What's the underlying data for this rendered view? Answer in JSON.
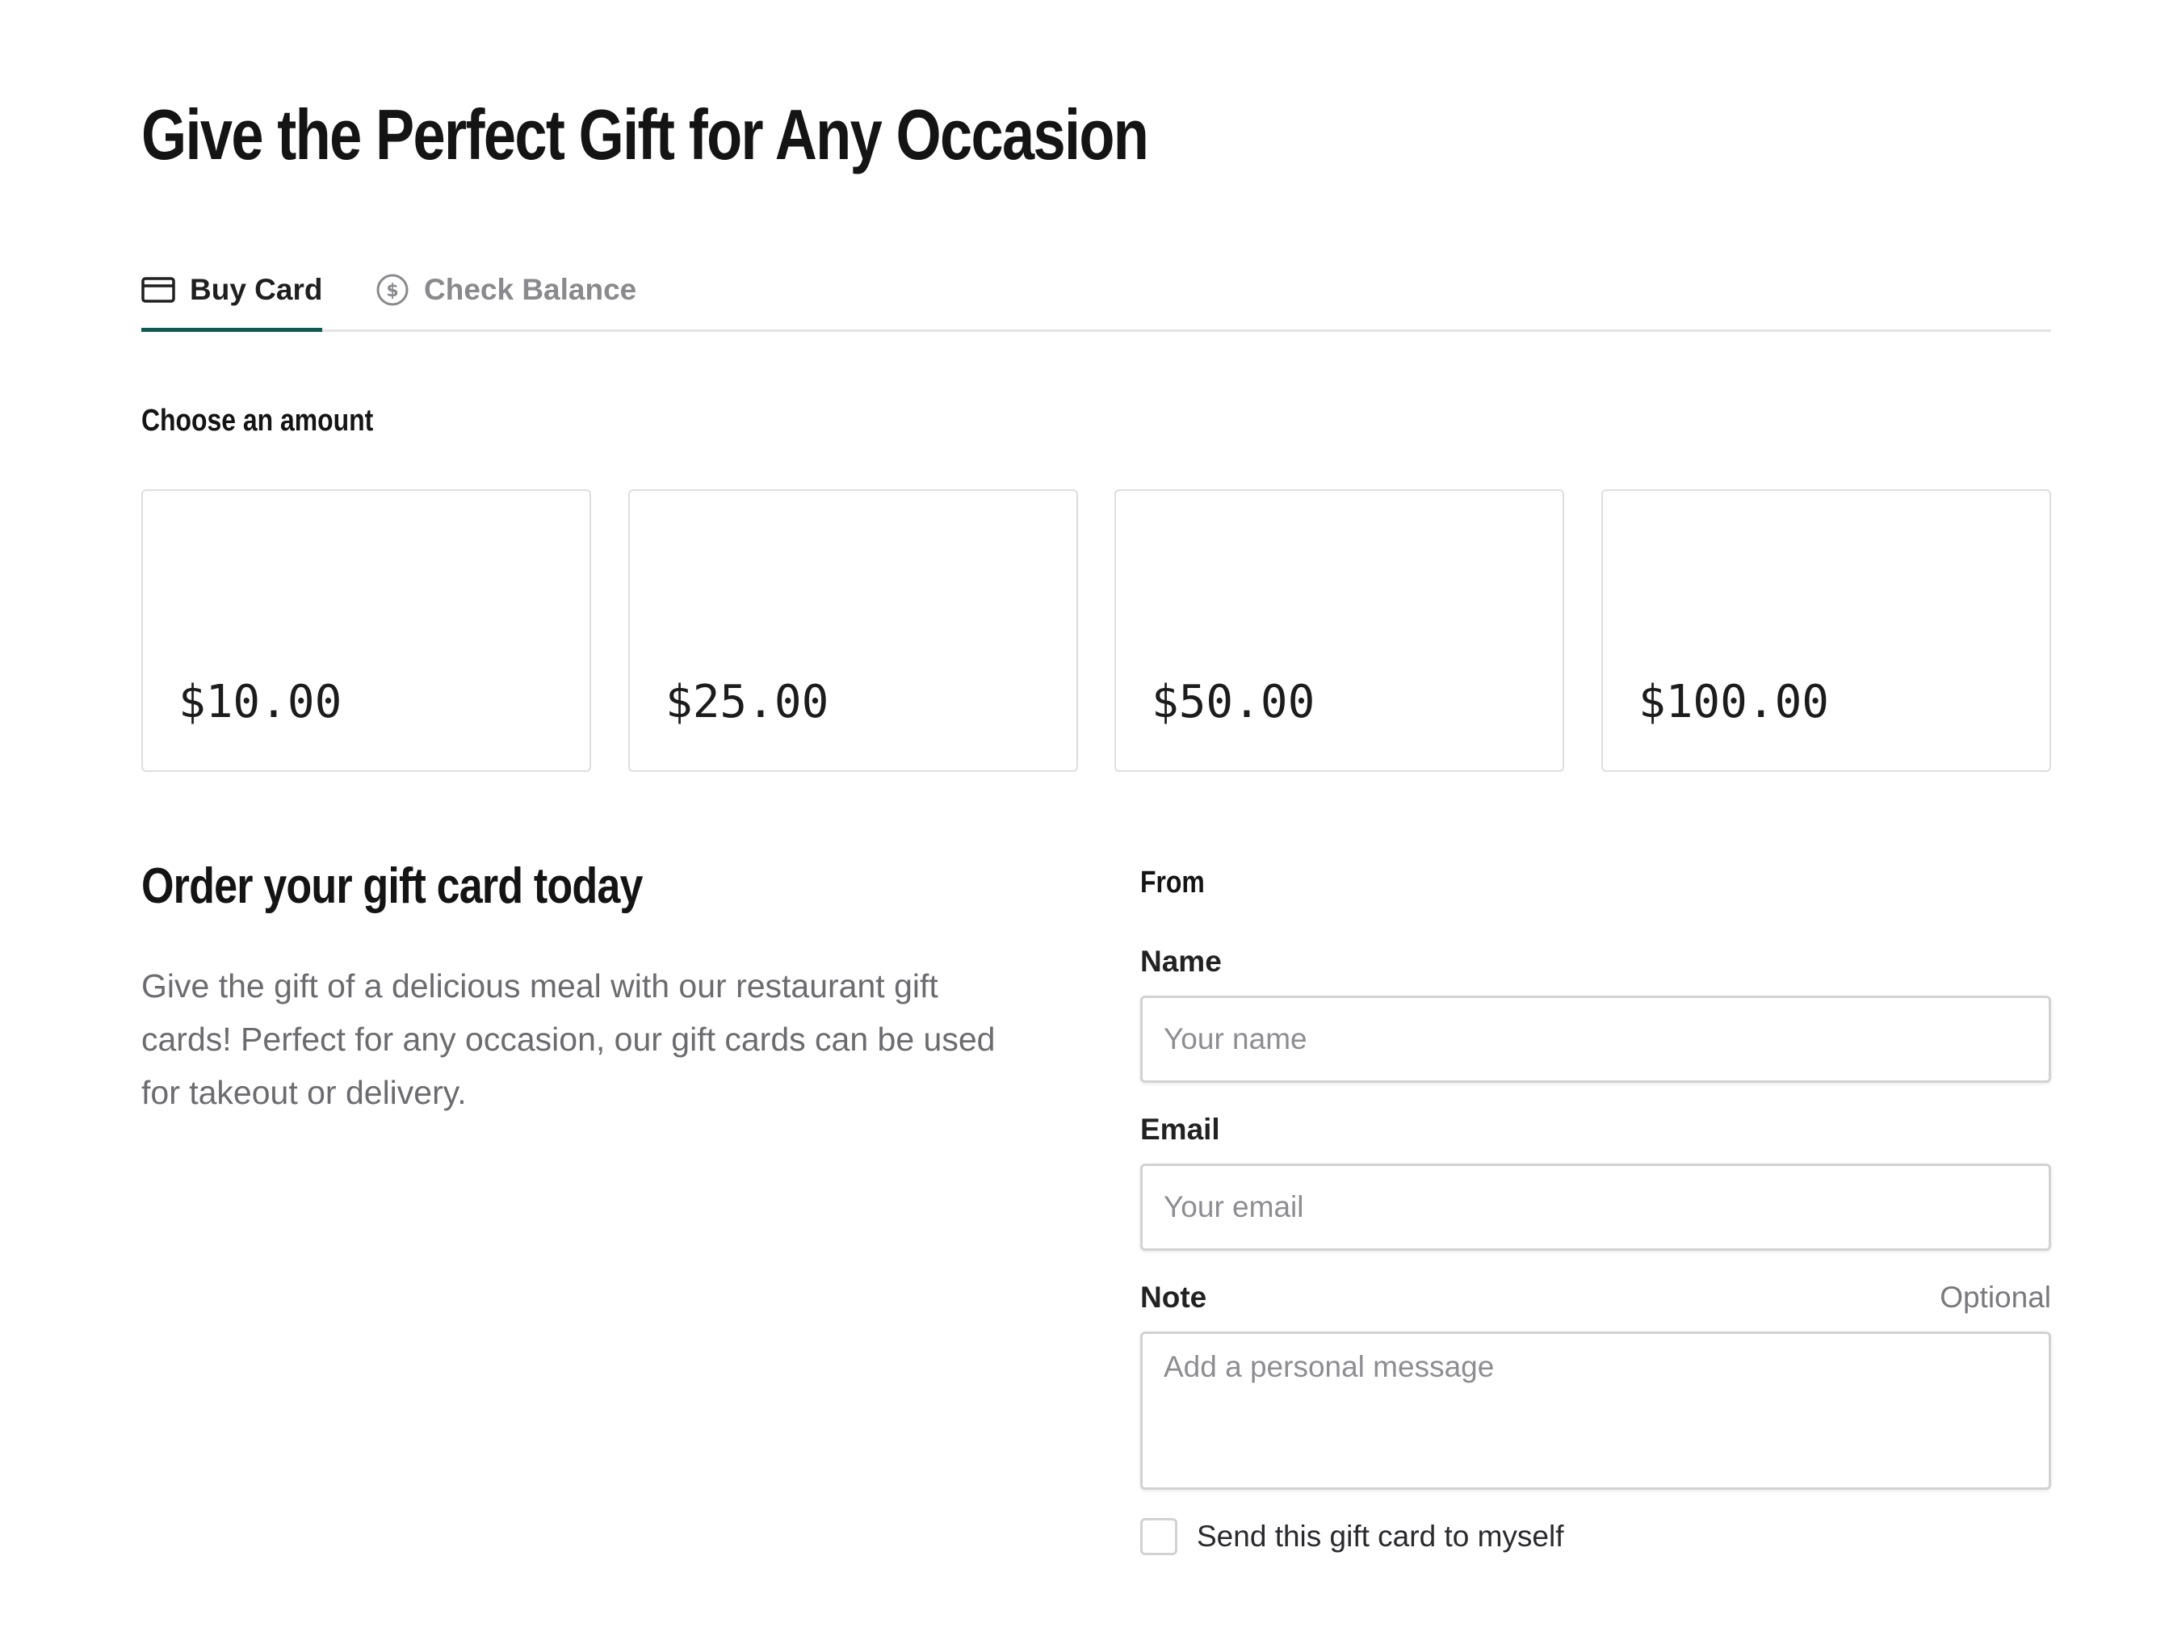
{
  "page": {
    "title": "Give the Perfect Gift for Any Occasion"
  },
  "tabs": [
    {
      "label": "Buy Card",
      "icon": "credit-card-icon",
      "active": true
    },
    {
      "label": "Check Balance",
      "icon": "dollar-circle-icon",
      "active": false
    }
  ],
  "amounts": {
    "label": "Choose an amount",
    "options": [
      "$10.00",
      "$25.00",
      "$50.00",
      "$100.00"
    ]
  },
  "order": {
    "heading": "Order your gift card today",
    "description": "Give the gift of a delicious meal with our restaurant gift cards! Perfect for any occasion, our gift cards can be used for takeout or delivery."
  },
  "form": {
    "section_label": "From",
    "name_label": "Name",
    "name_placeholder": "Your name",
    "email_label": "Email",
    "email_placeholder": "Your email",
    "note_label": "Note",
    "note_optional": "Optional",
    "note_placeholder": "Add a personal message",
    "send_to_self_label": "Send this gift card to myself"
  },
  "colors": {
    "accent": "#0f5a4f",
    "text_primary": "#141414",
    "text_muted": "#6b6b70",
    "border": "#d2d2d2"
  }
}
